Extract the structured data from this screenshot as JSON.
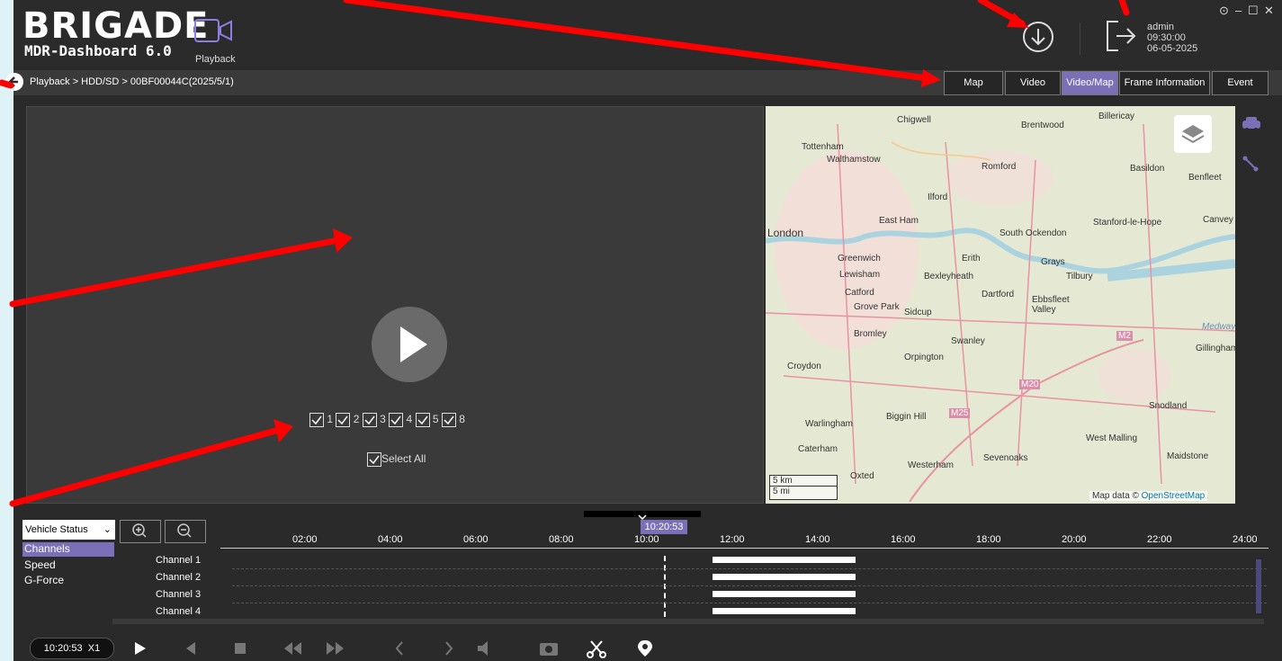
{
  "header": {
    "logo": "BRIGADE",
    "logo_sub": "MDR-Dashboard 6.0",
    "mode_label": "Playback",
    "user": "admin",
    "time": "09:30:00",
    "date": "06-05-2025",
    "window_controls": [
      "⊙",
      "–",
      "☐",
      "✕"
    ]
  },
  "nav": {
    "breadcrumb": "Playback > HDD/SD > 00BF00044C(2025/5/1)",
    "tabs": [
      {
        "label": "Map",
        "active": false
      },
      {
        "label": "Video",
        "active": false
      },
      {
        "label": "Video/Map",
        "active": true
      },
      {
        "label": "Frame Information",
        "active": false
      },
      {
        "label": "Event",
        "active": false
      }
    ]
  },
  "video": {
    "channels": [
      "1",
      "2",
      "3",
      "4",
      "5",
      "8"
    ],
    "select_all": "Select All"
  },
  "map": {
    "attribution_prefix": "Map data © ",
    "attribution_link": "OpenStreetMap",
    "scale_km": "5 km",
    "scale_mi": "5 mi",
    "places": [
      "Chigwell",
      "Brentwood",
      "Billericay",
      "Tottenham",
      "Walthamstow",
      "Romford",
      "Basildon",
      "Benfleet",
      "Ilford",
      "East Ham",
      "London",
      "Stanford-le-Hope",
      "Canvey",
      "South Ockendon",
      "Greenwich",
      "Erith",
      "Grays",
      "Tilbury",
      "Lewisham",
      "Bexleyheath",
      "Dartford",
      "Ebbsfleet Valley",
      "Catford",
      "Grove Park",
      "Sidcup",
      "Bromley",
      "Swanley",
      "Medway",
      "Gillingham",
      "Orpington",
      "Croydon",
      "Snodland",
      "Biggin Hill",
      "Warlingham",
      "West Malling",
      "Caterham",
      "Sevenoaks",
      "Westerham",
      "Oxted",
      "Maidstone",
      "M2",
      "M20",
      "M25"
    ]
  },
  "timeline": {
    "dropdown": "Vehicle Status",
    "menu": [
      "Channels",
      "Speed",
      "G-Force"
    ],
    "cursor_time": "10:20:53",
    "ticks": [
      "02:00",
      "04:00",
      "06:00",
      "08:00",
      "10:00",
      "12:00",
      "14:00",
      "16:00",
      "18:00",
      "20:00",
      "22:00",
      "24:00"
    ],
    "channels": [
      "Channel 1",
      "Channel 2",
      "Channel 3",
      "Channel 4"
    ],
    "segment_start": "11:00",
    "segment_end": "14:30"
  },
  "playback": {
    "time": "10:20:53",
    "speed": "X1"
  }
}
